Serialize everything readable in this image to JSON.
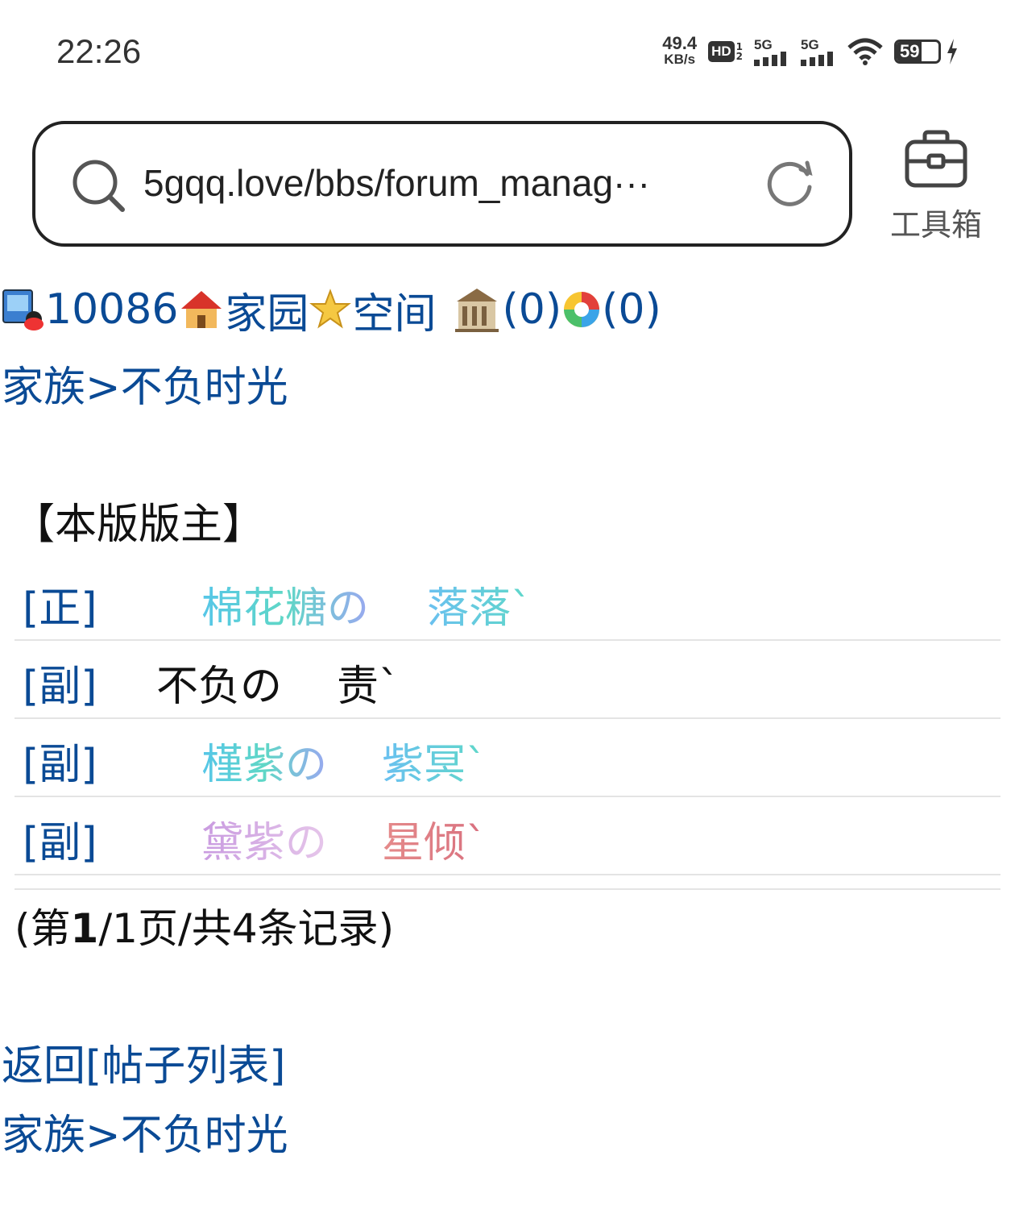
{
  "status": {
    "time": "22:26",
    "net_speed_value": "49.4",
    "net_speed_unit": "KB/s",
    "hd_label": "HD",
    "hd_sim_top": "1",
    "hd_sim_bottom": "2",
    "signal1_label": "5G",
    "signal2_label": "5G",
    "battery_level": "59",
    "battery_fraction": 0.59
  },
  "browser": {
    "url": "5gqq.love/bbs/forum_manag···",
    "toolbox_label": "工具箱"
  },
  "page": {
    "user_id": "10086",
    "home_label": "家园",
    "space_label": "空间",
    "msg_count": "(0)",
    "photo_count": "(0)",
    "crumb_top": "家族>不负时光",
    "moderators_title": "【本版版主】",
    "moderators": [
      {
        "role": "[正]",
        "name1": "棉花糖の",
        "name2": "落落ˋ"
      },
      {
        "role": "[副]",
        "name1": "不负の",
        "name2": "责ˋ"
      },
      {
        "role": "[副]",
        "name1": "槿紫の",
        "name2": "紫冥ˋ"
      },
      {
        "role": "[副]",
        "name1": "黛紫の",
        "name2": "星倾ˋ"
      }
    ],
    "paging_prefix": "(第",
    "paging_current": "1",
    "paging_suffix": "/1页/共4条记录)",
    "back_link": "返回[帖子列表]",
    "crumb_bottom": "家族>不负时光"
  }
}
